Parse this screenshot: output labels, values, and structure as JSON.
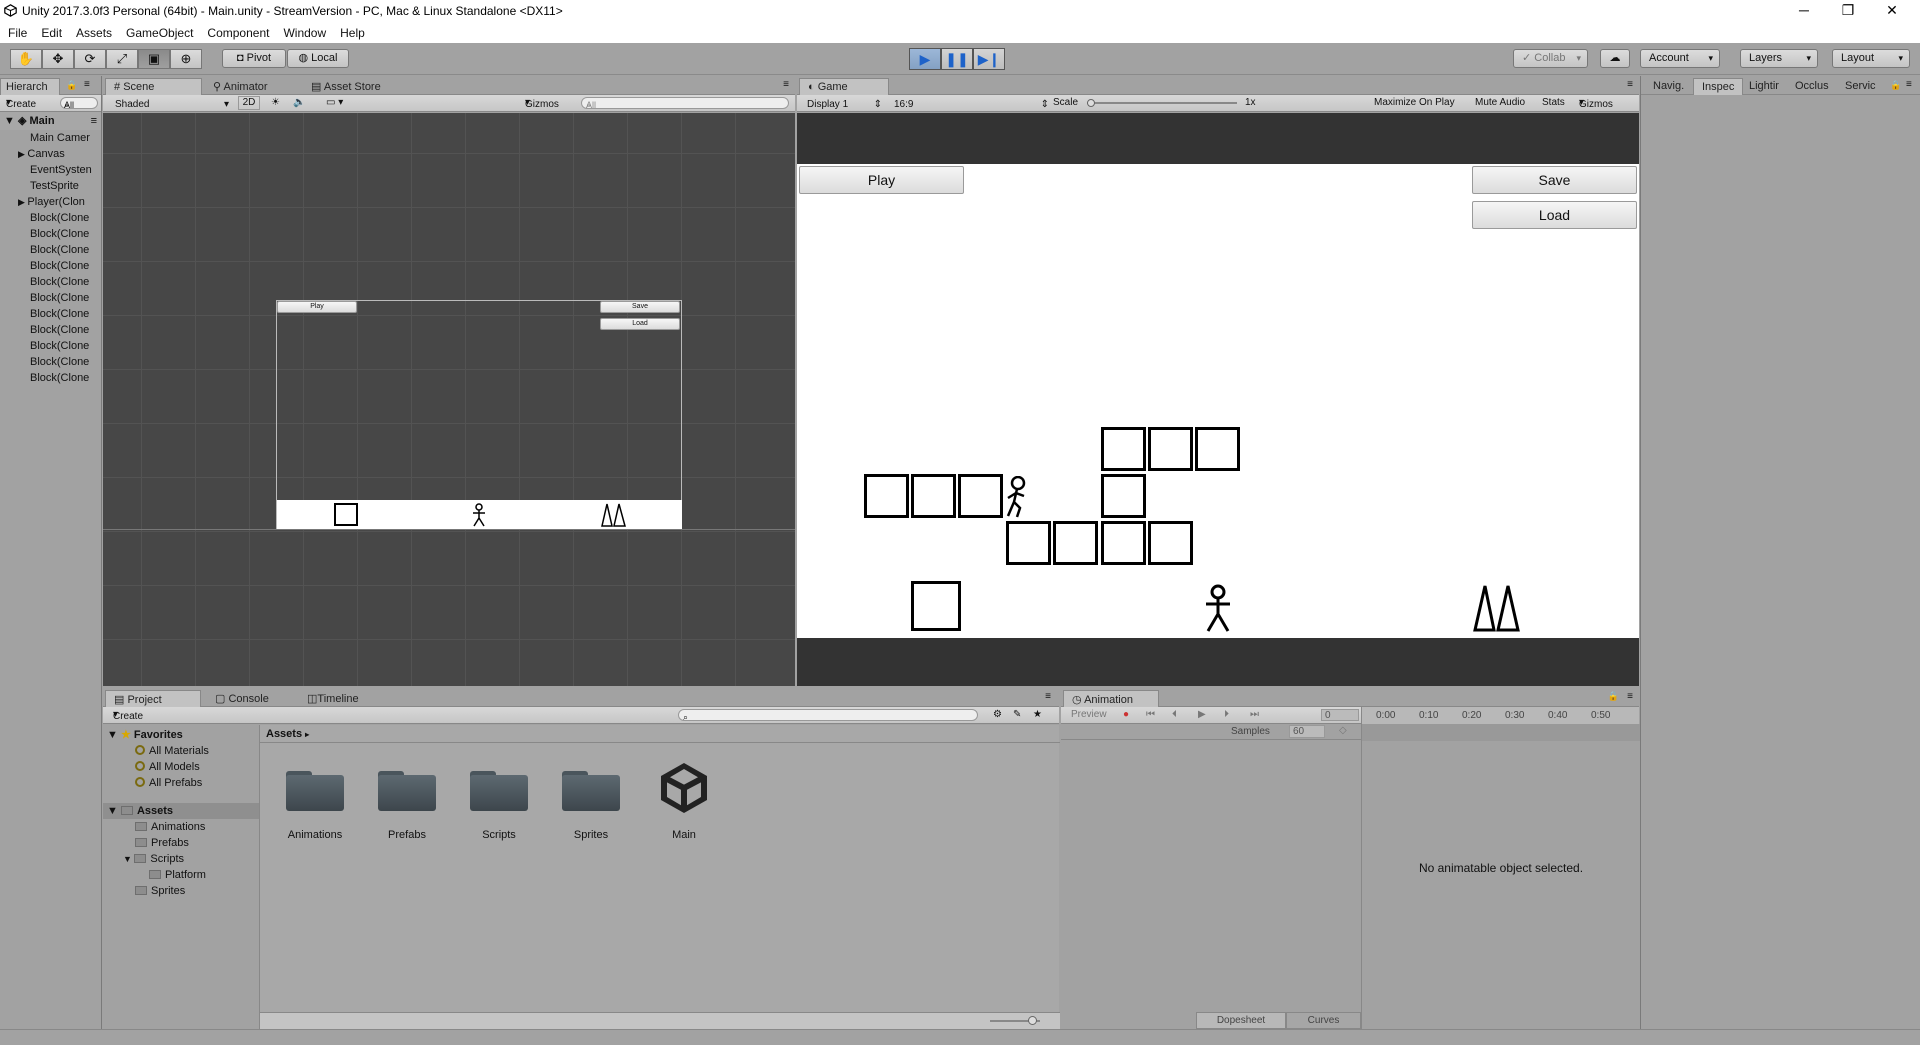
{
  "window": {
    "title": "Unity 2017.3.0f3 Personal (64bit) - Main.unity - StreamVersion - PC, Mac & Linux Standalone <DX11>",
    "minimize": "─",
    "restore": "❐",
    "close": "✕"
  },
  "menu": [
    "File",
    "Edit",
    "Assets",
    "GameObject",
    "Component",
    "Window",
    "Help"
  ],
  "toolbar": {
    "pivot": "Pivot",
    "local": "Local",
    "collab": "Collab",
    "account": "Account",
    "layers": "Layers",
    "layout": "Layout"
  },
  "hierarchy": {
    "tab": "Hierarch",
    "create": "Create",
    "search": "All",
    "scene": "Main",
    "items": [
      "Main Camer",
      "Canvas",
      "EventSysten",
      "TestSprite",
      "Player(Clon",
      "Block(Clone",
      "Block(Clone",
      "Block(Clone",
      "Block(Clone",
      "Block(Clone",
      "Block(Clone",
      "Block(Clone",
      "Block(Clone",
      "Block(Clone",
      "Block(Clone",
      "Block(Clone"
    ]
  },
  "scene_tabs": [
    "Scene",
    "Animator",
    "Asset Store"
  ],
  "scene_bar": {
    "shaded": "Shaded",
    "twod": "2D",
    "gizmos": "Gizmos",
    "search": "All"
  },
  "scene_preview": {
    "play": "Play",
    "save": "Save",
    "load": "Load"
  },
  "game": {
    "tab": "Game",
    "display": "Display 1",
    "aspect": "16:9",
    "scale_label": "Scale",
    "scale_value": "1x",
    "maximize": "Maximize On Play",
    "mute": "Mute Audio",
    "stats": "Stats",
    "gizmos": "Gizmos",
    "play_btn": "Play",
    "save_btn": "Save",
    "load_btn": "Load"
  },
  "inspector_tabs": [
    "Navig.",
    "Inspec",
    "Lightir",
    "Occlus",
    "Servic"
  ],
  "project": {
    "tabs": [
      "Project",
      "Console",
      "Timeline"
    ],
    "create": "Create",
    "favorites": "Favorites",
    "fav_items": [
      "All Materials",
      "All Models",
      "All Prefabs"
    ],
    "assets_root": "Assets",
    "tree": [
      "Animations",
      "Prefabs",
      "Scripts",
      "Platform",
      "Sprites"
    ],
    "breadcrumb": "Assets",
    "items": [
      "Animations",
      "Prefabs",
      "Scripts",
      "Sprites",
      "Main"
    ]
  },
  "animation": {
    "tab": "Animation",
    "preview": "Preview",
    "frame": "0",
    "samples_label": "Samples",
    "samples_value": "60",
    "timeline_ticks": [
      "0:00",
      "0:10",
      "0:20",
      "0:30",
      "0:40",
      "0:50"
    ],
    "empty_msg": "No animatable object selected.",
    "dopesheet": "Dopesheet",
    "curves": "Curves"
  }
}
